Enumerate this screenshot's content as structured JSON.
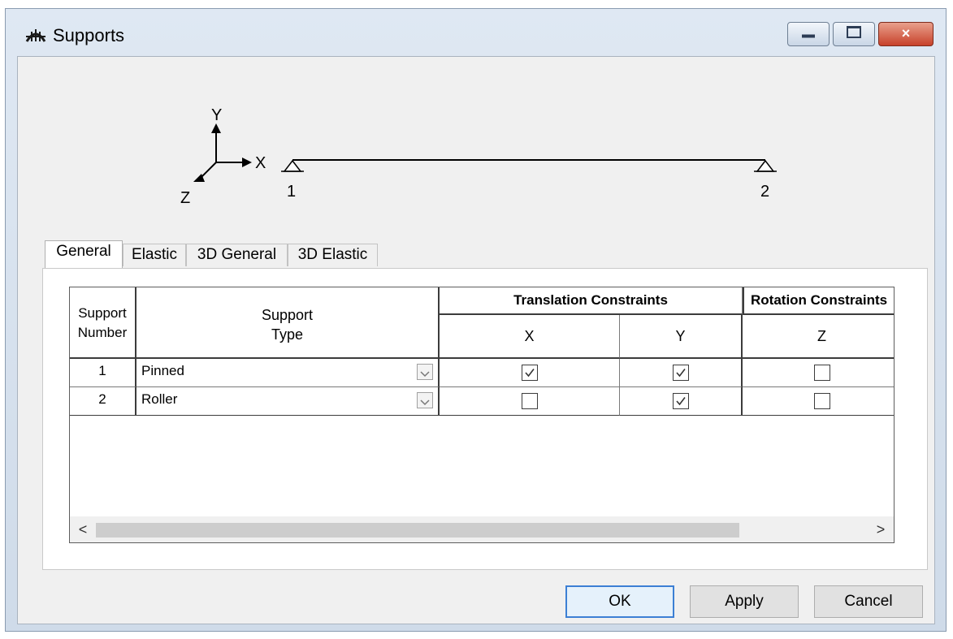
{
  "window": {
    "title": "Supports",
    "controls": {
      "minimize": "minimize",
      "maximize": "maximize",
      "close": "×"
    }
  },
  "diagram": {
    "axis_labels": {
      "y": "Y",
      "x": "X",
      "z": "Z"
    },
    "node_labels": [
      "1",
      "2"
    ]
  },
  "tabs": [
    {
      "label": "General",
      "active": true
    },
    {
      "label": "Elastic",
      "active": false
    },
    {
      "label": "3D General",
      "active": false
    },
    {
      "label": "3D Elastic",
      "active": false
    }
  ],
  "grid": {
    "headers": {
      "support_number": [
        "Support",
        "Number"
      ],
      "support_type": [
        "Support",
        "Type"
      ],
      "translation_group": "Translation Constraints",
      "translation_x": "X",
      "translation_y": "Y",
      "rotation_group": "Rotation Constraints",
      "rotation_z": "Z"
    },
    "rows": [
      {
        "number": "1",
        "type": "Pinned",
        "tx": true,
        "ty": true,
        "rz": false
      },
      {
        "number": "2",
        "type": "Roller",
        "tx": false,
        "ty": true,
        "rz": false
      }
    ],
    "scroll": {
      "left": "<",
      "right": ">"
    }
  },
  "buttons": {
    "ok": "OK",
    "apply": "Apply",
    "cancel": "Cancel"
  }
}
